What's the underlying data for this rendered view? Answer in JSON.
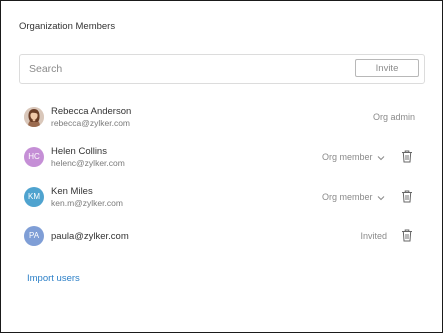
{
  "panel": {
    "title": "Organization Members"
  },
  "search": {
    "placeholder": "Search",
    "value": ""
  },
  "invite_button": {
    "label": "Invite"
  },
  "members": [
    {
      "name": "Rebecca Anderson",
      "email": "rebecca@zylker.com",
      "avatar": "photo",
      "role": "Org admin",
      "role_type": "static",
      "removable": false
    },
    {
      "name": "Helen Collins",
      "email": "helenc@zylker.com",
      "avatar_initials": "HC",
      "avatar_color": "#c58fd6",
      "role": "Org member",
      "role_type": "dropdown",
      "removable": true
    },
    {
      "name": "Ken Miles",
      "email": "ken.m@zylker.com",
      "avatar_initials": "KM",
      "avatar_color": "#4fa3cf",
      "role": "Org member",
      "role_type": "dropdown",
      "removable": true
    },
    {
      "email": "paula@zylker.com",
      "avatar_initials": "PA",
      "avatar_color": "#7f9ed6",
      "role": "Invited",
      "role_type": "status",
      "removable": true
    }
  ],
  "icons": {
    "role_dropdown": "chevron-down-icon",
    "remove": "trash-icon"
  },
  "import_link": {
    "label": "Import users",
    "color": "#2b7fc7"
  }
}
